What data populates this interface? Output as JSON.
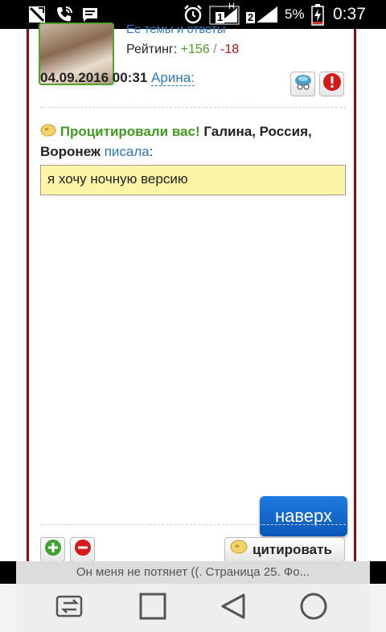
{
  "status_bar": {
    "network_h": "H",
    "sim1": "1",
    "sim2": "2",
    "battery_percent": "5%",
    "time": "0:37",
    "icons": [
      "no-sim-icon",
      "call-icon",
      "message-icon",
      "alarm-icon",
      "signal-icon",
      "battery-charging-icon"
    ]
  },
  "post": {
    "topics_link": "Ее темы и ответы",
    "rating_label": "Рейтинг:",
    "rating_plus": "+156",
    "rating_sep": " / ",
    "rating_minus": "-18",
    "date": "04.09.2016 00:31",
    "author": "Арина:",
    "quote_prefix": "Процитировали вас!",
    "quoted_user": "Галина, Россия, Воронеж",
    "wrote": "писала",
    "colon": ":",
    "quote_text": "я хочу ночную версию"
  },
  "actions": {
    "cite_label": "цитировать",
    "to_top_label": "наверх"
  },
  "browser": {
    "tab_title": "Он меня не потянет ((. Страница 25. Фо..."
  },
  "colors": {
    "frame": "#8b0a0a",
    "green": "#3f9a20",
    "link_blue": "#2a78bf",
    "quote_bg": "#fdf5a6",
    "top_button": "#0a56b8"
  }
}
